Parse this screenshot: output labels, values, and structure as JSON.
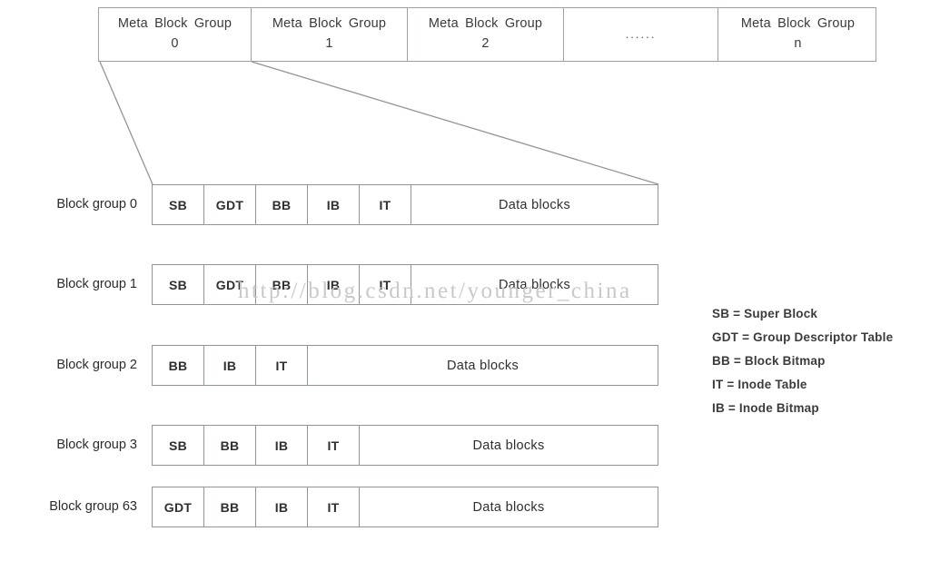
{
  "meta_strip": {
    "cells": [
      {
        "title": "Meta Block Group",
        "number": "0",
        "kind": "group"
      },
      {
        "title": "Meta Block Group",
        "number": "1",
        "kind": "group"
      },
      {
        "title": "Meta Block Group",
        "number": "2",
        "kind": "group"
      },
      {
        "title": "",
        "number": "......",
        "kind": "ellipsis"
      },
      {
        "title": "Meta Block Group",
        "number": "n",
        "kind": "group"
      }
    ]
  },
  "block_groups": [
    {
      "label": "Block group 0",
      "cells": [
        "SB",
        "GDT",
        "BB",
        "IB",
        "IT"
      ],
      "data_label": "Data blocks"
    },
    {
      "label": "Block group 1",
      "cells": [
        "SB",
        "GDT",
        "BB",
        "IB",
        "IT"
      ],
      "data_label": "Data blocks"
    },
    {
      "label": "Block group 2",
      "cells": [
        "BB",
        "IB",
        "IT"
      ],
      "data_label": "Data blocks"
    },
    {
      "label": "Block group 3",
      "cells": [
        "SB",
        "BB",
        "IB",
        "IT"
      ],
      "data_label": "Data blocks"
    },
    {
      "label": "Block group 63",
      "cells": [
        "GDT",
        "BB",
        "IB",
        "IT"
      ],
      "data_label": "Data blocks"
    }
  ],
  "legend": [
    {
      "key": "SB",
      "value": "Super Block"
    },
    {
      "key": "GDT",
      "value": "Group Descriptor Table"
    },
    {
      "key": "BB",
      "value": "Block Bitmap"
    },
    {
      "key": "IT",
      "value": "Inode Table"
    },
    {
      "key": "IB",
      "value": "Inode Bitmap"
    }
  ],
  "watermark": {
    "text": "http://blog.csdn.net/younger_china"
  },
  "colors": {
    "stroke": "#8f959b",
    "meta_stroke": "#9aa0a6",
    "text": "#2b2b2b",
    "watermark": "#c9c9c9",
    "background": "#ffffff"
  }
}
